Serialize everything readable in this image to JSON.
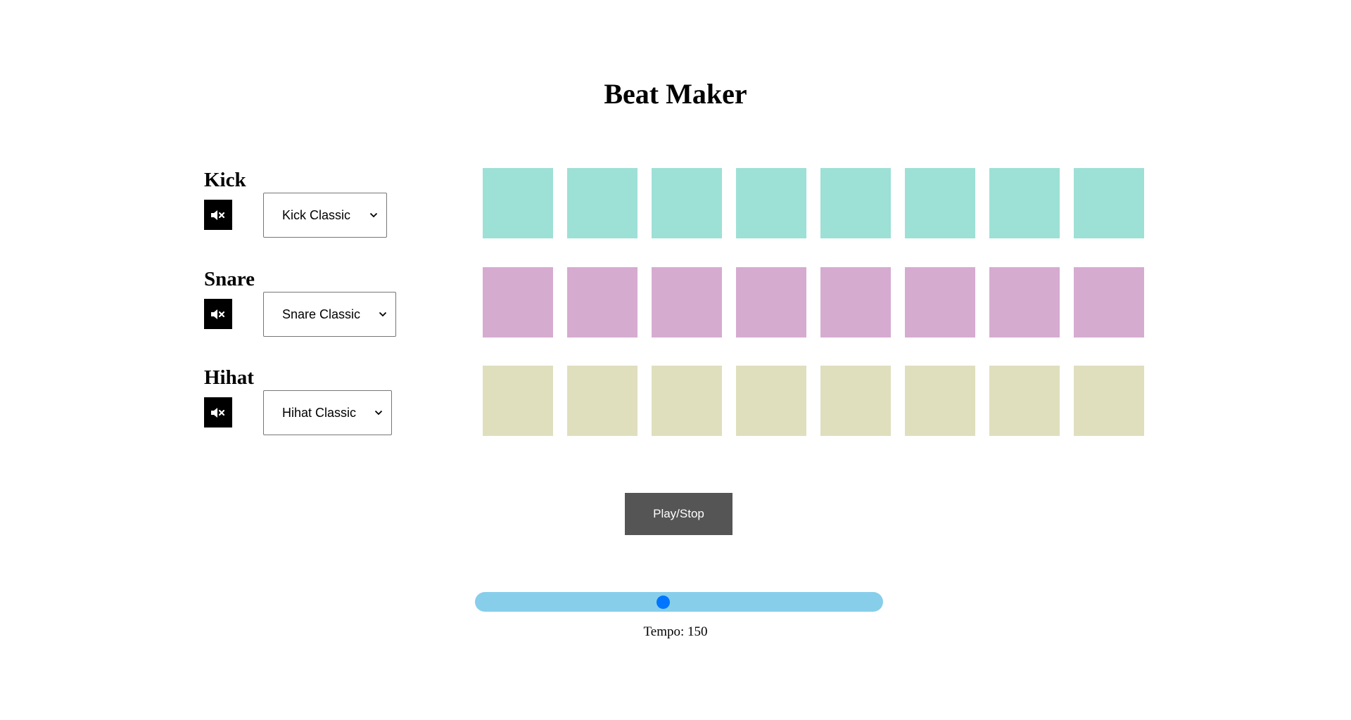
{
  "page": {
    "title": "Beat Maker"
  },
  "tracks": [
    {
      "name": "Kick",
      "mute_icon": "speaker-muted-icon",
      "selected_sound": "Kick Classic",
      "pad_color": "#9de0d6",
      "steps": [
        false,
        false,
        false,
        false,
        false,
        false,
        false,
        false
      ]
    },
    {
      "name": "Snare",
      "mute_icon": "speaker-muted-icon",
      "selected_sound": "Snare Classic",
      "pad_color": "#d6abd0",
      "steps": [
        false,
        false,
        false,
        false,
        false,
        false,
        false,
        false
      ]
    },
    {
      "name": "Hihat",
      "mute_icon": "speaker-muted-icon",
      "selected_sound": "Hihat Classic",
      "pad_color": "#dfdfbe",
      "steps": [
        false,
        false,
        false,
        false,
        false,
        false,
        false,
        false
      ]
    }
  ],
  "controls": {
    "play_label": "Play/Stop",
    "play_color": "#555555"
  },
  "tempo": {
    "label": "Tempo: 150",
    "value": 150,
    "level": 0.46,
    "track_color": "#87ceeb",
    "thumb_color": "#0075ff"
  }
}
